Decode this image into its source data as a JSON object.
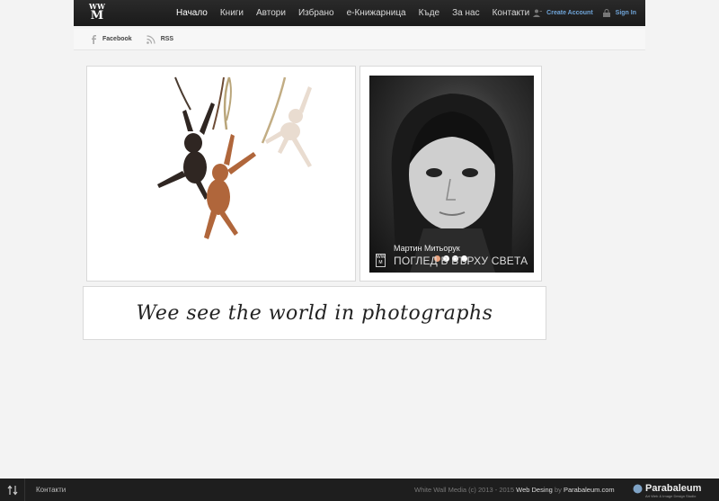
{
  "header": {
    "logo_top": "WW",
    "logo_bottom": "M",
    "nav": [
      "Начало",
      "Книги",
      "Автори",
      "Избрано",
      "е-Книжарница",
      "Къде",
      "За нас",
      "Контакти"
    ],
    "create_account": "Create Account",
    "sign_in": "Sign In"
  },
  "social": {
    "facebook": "Facebook",
    "rss": "RSS"
  },
  "slider": {
    "author": "Мартин Митьорук",
    "title": "ПОГЛЕД В ВЪРХУ СВЕТА",
    "logo_text": "WW M",
    "slides": 4,
    "active_slide": 1
  },
  "tagline": "Wee see the world in photographs",
  "footer": {
    "link": "Контакти",
    "copyright": "White Wall Media (c) 2013 - 2015",
    "web_design": "Web Desing",
    "by": "by",
    "company": "Parabaleum.com",
    "brand": "Parabaleum",
    "brand_sub": "Art Web & Image Design Studio"
  },
  "colors": {
    "accent": "#6fa4d8",
    "topbar": "#1a1a1a",
    "background": "#f3f3f3"
  }
}
